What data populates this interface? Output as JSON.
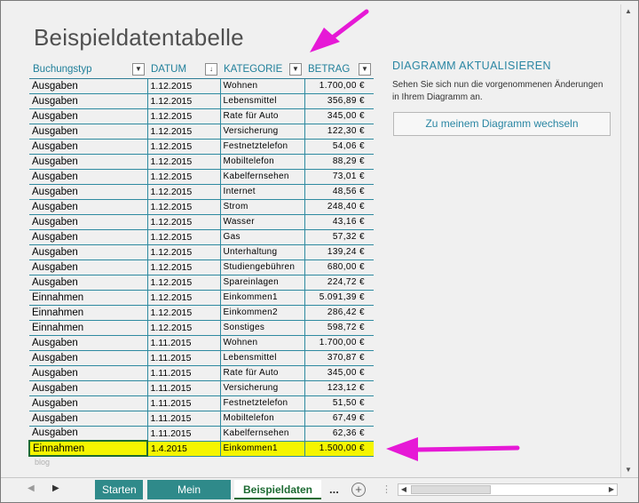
{
  "title": "Beispieldatentabelle",
  "table": {
    "headers": [
      "Buchungstyp",
      "DATUM",
      "KATEGORIE",
      "BETRAG"
    ],
    "rows": [
      [
        "Ausgaben",
        "1.12.2015",
        "Wohnen",
        "1.700,00 €"
      ],
      [
        "Ausgaben",
        "1.12.2015",
        "Lebensmittel",
        "356,89 €"
      ],
      [
        "Ausgaben",
        "1.12.2015",
        "Rate für Auto",
        "345,00 €"
      ],
      [
        "Ausgaben",
        "1.12.2015",
        "Versicherung",
        "122,30 €"
      ],
      [
        "Ausgaben",
        "1.12.2015",
        "Festnetztelefon",
        "54,06 €"
      ],
      [
        "Ausgaben",
        "1.12.2015",
        "Mobiltelefon",
        "88,29 €"
      ],
      [
        "Ausgaben",
        "1.12.2015",
        "Kabelfernsehen",
        "73,01 €"
      ],
      [
        "Ausgaben",
        "1.12.2015",
        "Internet",
        "48,56 €"
      ],
      [
        "Ausgaben",
        "1.12.2015",
        "Strom",
        "248,40 €"
      ],
      [
        "Ausgaben",
        "1.12.2015",
        "Wasser",
        "43,16 €"
      ],
      [
        "Ausgaben",
        "1.12.2015",
        "Gas",
        "57,32 €"
      ],
      [
        "Ausgaben",
        "1.12.2015",
        "Unterhaltung",
        "139,24 €"
      ],
      [
        "Ausgaben",
        "1.12.2015",
        "Studiengebühren",
        "680,00 €"
      ],
      [
        "Ausgaben",
        "1.12.2015",
        "Spareinlagen",
        "224,72 €"
      ],
      [
        "Einnahmen",
        "1.12.2015",
        "Einkommen1",
        "5.091,39 €"
      ],
      [
        "Einnahmen",
        "1.12.2015",
        "Einkommen2",
        "286,42 €"
      ],
      [
        "Einnahmen",
        "1.12.2015",
        "Sonstiges",
        "598,72 €"
      ],
      [
        "Ausgaben",
        "1.11.2015",
        "Wohnen",
        "1.700,00 €"
      ],
      [
        "Ausgaben",
        "1.11.2015",
        "Lebensmittel",
        "370,87 €"
      ],
      [
        "Ausgaben",
        "1.11.2015",
        "Rate für Auto",
        "345,00 €"
      ],
      [
        "Ausgaben",
        "1.11.2015",
        "Versicherung",
        "123,12 €"
      ],
      [
        "Ausgaben",
        "1.11.2015",
        "Festnetztelefon",
        "51,50 €"
      ],
      [
        "Ausgaben",
        "1.11.2015",
        "Mobiltelefon",
        "67,49 €"
      ],
      [
        "Ausgaben",
        "1.11.2015",
        "Kabelfernsehen",
        "62,36 €"
      ],
      [
        "Einnahmen",
        "1.4.2015",
        "Einkommen1",
        "1.500,00 €"
      ]
    ],
    "highlight_row_index": 24,
    "highlight_color": "#f5f500"
  },
  "side_panel": {
    "heading": "DIAGRAMM AKTUALISIEREN",
    "text": "Sehen Sie sich nun die vorgenommenen Änderungen in Ihrem Diagramm an.",
    "button_label": "Zu meinem Diagramm wechseln"
  },
  "watermark": "blog",
  "tabs": [
    {
      "label": "Starten",
      "active": false
    },
    {
      "label": "Mein Cashflow",
      "active": false
    },
    {
      "label": "Beispieldaten",
      "active": true
    }
  ],
  "more_tabs_label": "...",
  "add_sheet_icon": "plus-circle-icon",
  "colors": {
    "accent": "#2a86a3",
    "tab_bg": "#2f8a8a",
    "active_tab_text": "#1d6b33",
    "arrow": "#e619d6"
  }
}
